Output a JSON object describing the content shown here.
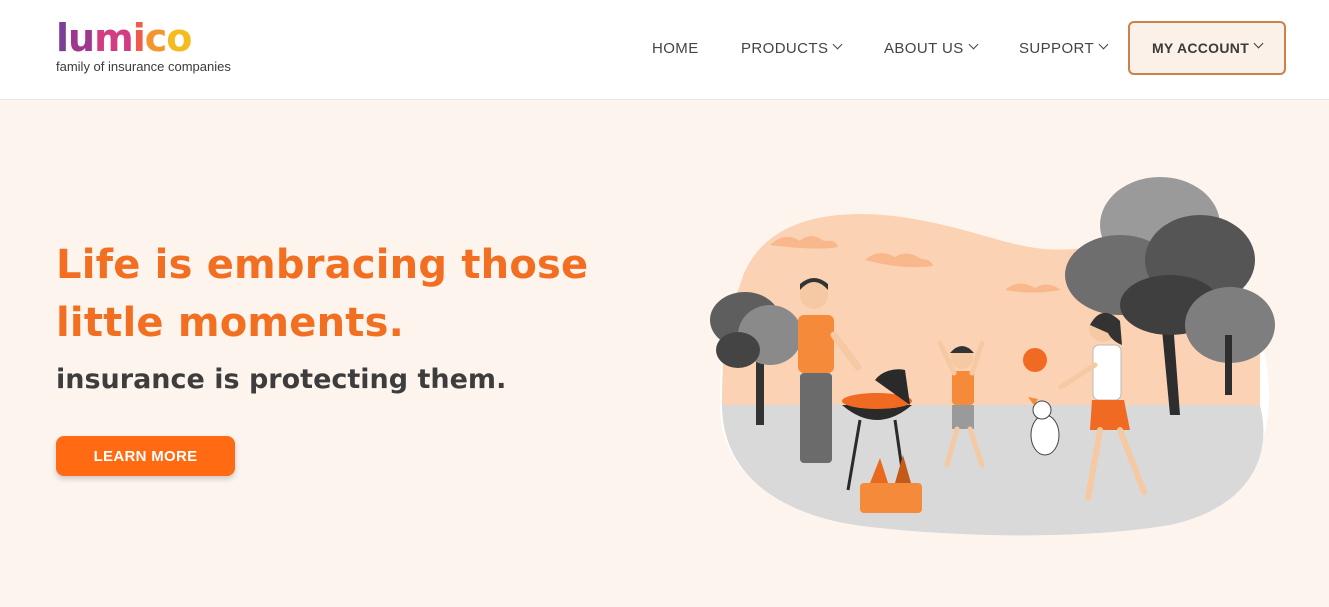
{
  "brand": {
    "name_letters": [
      "L",
      "u",
      "m",
      "i",
      "c",
      "o"
    ],
    "name_display": "lumico",
    "tagline": "family of insurance companies",
    "logo_colors": [
      "#7b3f98",
      "#b0388c",
      "#e0457b",
      "#f26a3d",
      "#f5a623",
      "#f7c21b"
    ]
  },
  "nav": {
    "items": [
      {
        "label": "HOME",
        "has_dropdown": false
      },
      {
        "label": "PRODUCTS",
        "has_dropdown": true
      },
      {
        "label": "ABOUT US",
        "has_dropdown": true
      },
      {
        "label": "SUPPORT",
        "has_dropdown": true
      }
    ],
    "account_label": "MY ACCOUNT"
  },
  "hero": {
    "headline_line1": "Life is embracing those",
    "headline_line2": "little moments.",
    "subhead": "insurance is protecting them.",
    "cta_label": "LEARN MORE"
  },
  "colors": {
    "accent": "#ff6a13",
    "headline": "#f26f21",
    "hero_bg": "#fdf4ee",
    "account_border": "#c9834a"
  },
  "icons": {
    "dropdown": "chevron-down-icon"
  }
}
